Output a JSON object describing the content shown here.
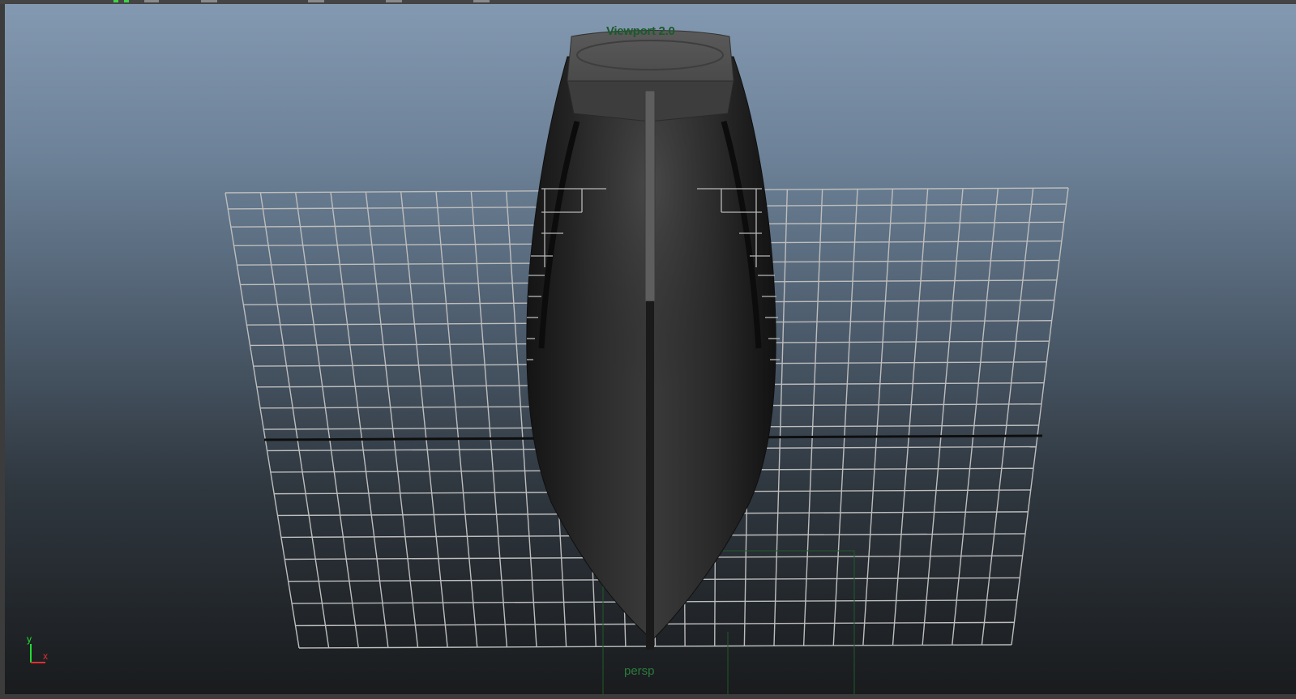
{
  "viewport": {
    "renderer_label": "Viewport 2.0",
    "camera_label": "persp"
  },
  "axis_gizmo": {
    "y_label": "y",
    "x_label": "x",
    "y_color": "#22dd33",
    "x_color": "#e03030"
  },
  "colors": {
    "grid_line": "#bdbdbd",
    "grid_axis": "#111111",
    "hud_text": "#1f6b33",
    "sky_top": "#8399b1",
    "ground_bottom": "#191b1d"
  },
  "scene": {
    "object": "boat-hull",
    "grid_visible": true
  }
}
